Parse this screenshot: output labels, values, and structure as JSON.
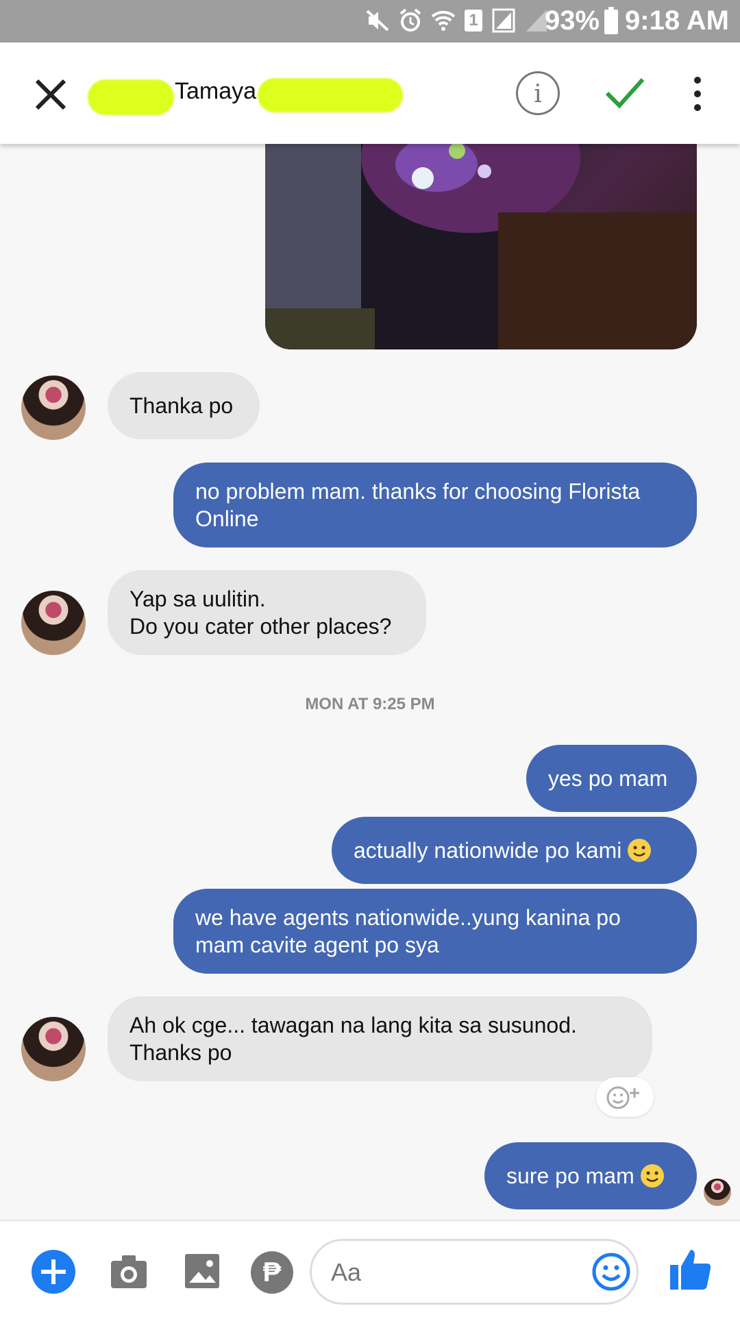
{
  "status_bar": {
    "battery": "93%",
    "time": "9:18 AM",
    "sim_slot": "1"
  },
  "header": {
    "contact_name": "Tamaya",
    "close_icon": "close-icon",
    "info_icon": "info-icon",
    "check_icon": "check-icon",
    "more_icon": "more-vertical-icon",
    "info_glyph": "i"
  },
  "messages": [
    {
      "side": "in",
      "text": "Thanka po"
    },
    {
      "side": "out",
      "text": "no problem mam. thanks for choosing Florista Online"
    },
    {
      "side": "in",
      "lines": [
        "Yap sa uulitin.",
        "Do you cater other places?"
      ]
    },
    {
      "side": "out",
      "text": "yes po mam"
    },
    {
      "side": "out",
      "text": "actually nationwide po kami",
      "emoji": "slight-smile"
    },
    {
      "side": "out",
      "text": "we have agents nationwide..yung kanina po mam cavite agent po sya"
    },
    {
      "side": "in",
      "text": "Ah ok cge... tawagan na lang kita sa susunod. Thanks po"
    },
    {
      "side": "out",
      "text": "sure po mam",
      "emoji": "slight-smile"
    }
  ],
  "timestamp": "MON AT 9:25 PM",
  "composer": {
    "placeholder": "Aa",
    "pay_glyph": "₱"
  },
  "colors": {
    "outgoing_bubble": "#4367b2",
    "incoming_bubble": "#e6e6e6",
    "accent": "#1c7cf0",
    "check": "#2e9e3e"
  }
}
